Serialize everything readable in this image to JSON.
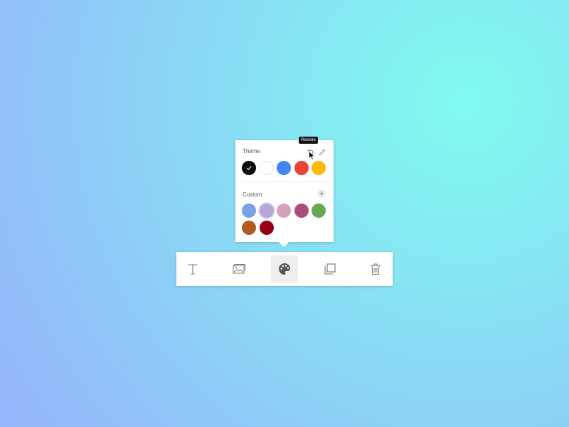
{
  "popover": {
    "theme_label": "Theme",
    "custom_label": "Custom",
    "tooltip": "Restore",
    "theme_colors": [
      "#0a0a0a",
      "#ffffff",
      "#4285f4",
      "#ea4335",
      "#fbbc05"
    ],
    "selected_theme_color": "#0a0a0a",
    "custom_colors": [
      "#78a2e2",
      "#b6a6db",
      "#d6a2bb",
      "#a94d7b",
      "#67a653",
      "#b35c1d",
      "#990013"
    ],
    "hovered_custom_color": "#b6a6db",
    "icons": {
      "restore": "restore-icon",
      "edit": "pencil-icon",
      "add": "plus-icon"
    }
  },
  "toolbar": {
    "active_tool": "color",
    "tools": [
      {
        "id": "text",
        "icon": "text-icon"
      },
      {
        "id": "image",
        "icon": "image-icon"
      },
      {
        "id": "color",
        "icon": "palette-icon"
      },
      {
        "id": "duplicate",
        "icon": "duplicate-icon"
      },
      {
        "id": "delete",
        "icon": "trash-icon"
      }
    ]
  }
}
